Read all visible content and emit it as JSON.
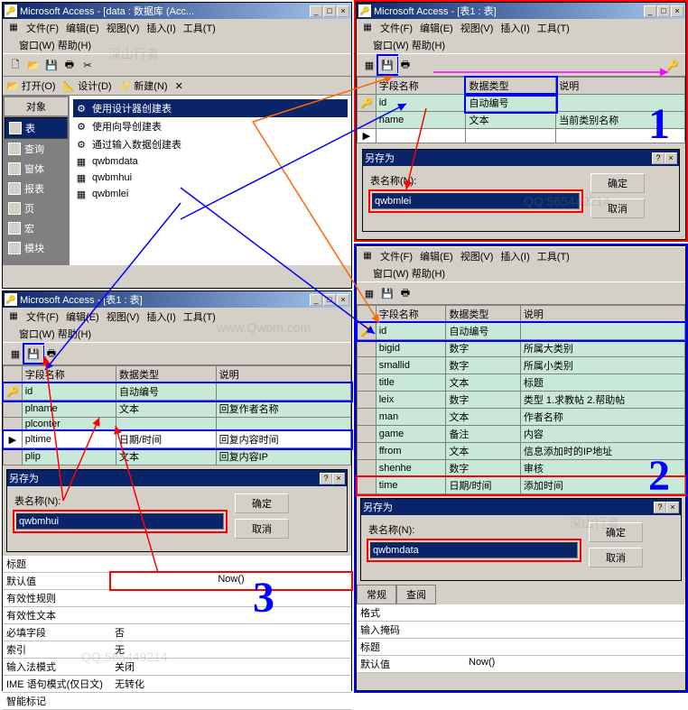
{
  "winA": {
    "title": "Microsoft Access - [data : 数据库 (Acc...",
    "menus": [
      "文件(F)",
      "编辑(E)",
      "视图(V)",
      "插入(I)",
      "工具(T)",
      "窗口(W)",
      "帮助(H)"
    ],
    "dbToolbar": {
      "open": "打开(O)",
      "design": "设计(D)",
      "new": "新建(N)"
    },
    "objHeader": "对象",
    "objItems": [
      "表",
      "查询",
      "窗体",
      "报表",
      "页",
      "宏",
      "模块"
    ],
    "listItems": [
      "使用设计器创建表",
      "使用向导创建表",
      "通过输入数据创建表",
      "qwbmdata",
      "qwbmhui",
      "qwbmlei"
    ]
  },
  "winB": {
    "title": "Microsoft Access - [表1 : 表]",
    "menus": [
      "文件(F)",
      "编辑(E)",
      "视图(V)",
      "插入(I)",
      "工具(T)",
      "窗口(W)",
      "帮助(H)"
    ],
    "gridHeaders": [
      "字段名称",
      "数据类型",
      "说明"
    ],
    "rows": [
      {
        "sel": "🔑",
        "name": "id",
        "type": "自动编号",
        "desc": ""
      },
      {
        "sel": "",
        "name": "name",
        "type": "文本",
        "desc": "当前类别名称"
      },
      {
        "sel": "▶",
        "name": "",
        "type": "",
        "desc": ""
      }
    ],
    "saveTitle": "另存为",
    "saveLabel": "表名称(N):",
    "saveValue": "qwbmlei",
    "ok": "确定",
    "cancel": "取消"
  },
  "winC": {
    "title": "Microsoft Access - [表1 : 表]",
    "menus": [
      "文件(F)",
      "编辑(E)",
      "视图(V)",
      "插入(I)",
      "工具(T)",
      "窗口(W)",
      "帮助(H)"
    ],
    "gridHeaders": [
      "字段名称",
      "数据类型",
      "说明"
    ],
    "rows": [
      {
        "sel": "🔑",
        "name": "id",
        "type": "自动编号",
        "desc": ""
      },
      {
        "sel": "",
        "name": "plname",
        "type": "文本",
        "desc": "回复作者名称"
      },
      {
        "sel": "",
        "name": "plconter",
        "type": "",
        "desc": ""
      },
      {
        "sel": "▶",
        "name": "pltime",
        "type": "日期/时间",
        "desc": "回复内容时间"
      },
      {
        "sel": "",
        "name": "plip",
        "type": "文本",
        "desc": "回复内容IP"
      }
    ],
    "saveTitle": "另存为",
    "saveLabel": "表名称(N):",
    "saveValue": "qwbmhui",
    "ok": "确定",
    "cancel": "取消",
    "props": [
      {
        "label": "标题",
        "value": ""
      },
      {
        "label": "默认值",
        "value": "Now()"
      },
      {
        "label": "有效性规则",
        "value": ""
      },
      {
        "label": "有效性文本",
        "value": ""
      },
      {
        "label": "必填字段",
        "value": "否"
      },
      {
        "label": "索引",
        "value": "无"
      },
      {
        "label": "输入法模式",
        "value": "关闭"
      },
      {
        "label": "IME 语句模式(仅日文)",
        "value": "无转化"
      },
      {
        "label": "智能标记",
        "value": ""
      }
    ]
  },
  "winD": {
    "menus": [
      "文件(F)",
      "编辑(E)",
      "视图(V)",
      "插入(I)",
      "工具(T)",
      "窗口(W)",
      "帮助(H)"
    ],
    "gridHeaders": [
      "字段名称",
      "数据类型",
      "说明"
    ],
    "rows": [
      {
        "sel": "🔑",
        "name": "id",
        "type": "自动编号",
        "desc": ""
      },
      {
        "sel": "",
        "name": "bigid",
        "type": "数字",
        "desc": "所属大类别"
      },
      {
        "sel": "",
        "name": "smallid",
        "type": "数字",
        "desc": "所属小类别"
      },
      {
        "sel": "",
        "name": "title",
        "type": "文本",
        "desc": "标题"
      },
      {
        "sel": "",
        "name": "leix",
        "type": "数字",
        "desc": "类型 1.求教帖 2.帮助帖"
      },
      {
        "sel": "",
        "name": "man",
        "type": "文本",
        "desc": "作者名称"
      },
      {
        "sel": "",
        "name": "game",
        "type": "备注",
        "desc": "内容"
      },
      {
        "sel": "",
        "name": "ffrom",
        "type": "文本",
        "desc": "信息添加时的IP地址"
      },
      {
        "sel": "",
        "name": "shenhe",
        "type": "数字",
        "desc": "审核"
      },
      {
        "sel": "",
        "name": "time",
        "type": "日期/时间",
        "desc": "添加时间"
      }
    ],
    "saveTitle": "另存为",
    "saveLabel": "表名称(N):",
    "saveValue": "qwbmdata",
    "ok": "确定",
    "cancel": "取消",
    "propTabs": [
      "常规",
      "查阅"
    ],
    "props": [
      {
        "label": "格式",
        "value": ""
      },
      {
        "label": "输入掩码",
        "value": ""
      },
      {
        "label": "标题",
        "value": ""
      },
      {
        "label": "默认值",
        "value": "Now()"
      }
    ]
  },
  "watermarks": {
    "a": "深山行者",
    "b": "www.Qwbm.com",
    "c": "QQ:565449214"
  }
}
